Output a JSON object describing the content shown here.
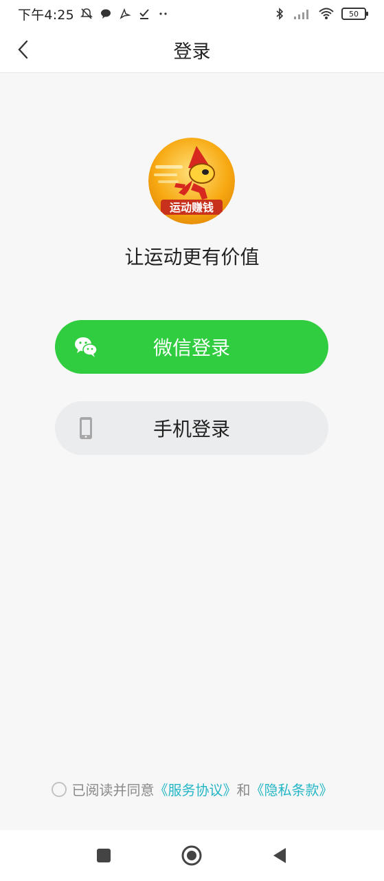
{
  "status_bar": {
    "time": "下午4:25",
    "battery_level": "50",
    "icons_left": [
      "mute-bell-icon",
      "chat-bubble-icon",
      "bird-icon",
      "check-download-icon",
      "more-dots-icon"
    ],
    "icons_right": [
      "bluetooth-icon",
      "signal-icon",
      "wifi-icon",
      "battery-icon"
    ]
  },
  "app_bar": {
    "title": "登录",
    "back_icon": "back-chevron-icon"
  },
  "logo": {
    "badge_text": "运动赚钱",
    "colors": {
      "outer": "#f7a912",
      "inner": "#ffe07a",
      "character": "#d6281f"
    }
  },
  "slogan": "让运动更有价值",
  "buttons": {
    "wechat_label": "微信登录",
    "wechat_icon": "wechat-icon",
    "phone_label": "手机登录",
    "phone_icon": "phone-icon"
  },
  "agreement": {
    "prefix": "已阅读并同意",
    "service_link": "《服务协议》",
    "connector": "和",
    "privacy_link": "《隐私条款》",
    "checked": false
  },
  "nav_bar": {
    "items": [
      "recents-square-icon",
      "home-circle-icon",
      "back-triangle-icon"
    ]
  },
  "colors": {
    "wechat_green": "#2fcd3f",
    "link_teal": "#24b6c6",
    "background": "#f7f7f7",
    "secondary_button": "#ebeced"
  }
}
